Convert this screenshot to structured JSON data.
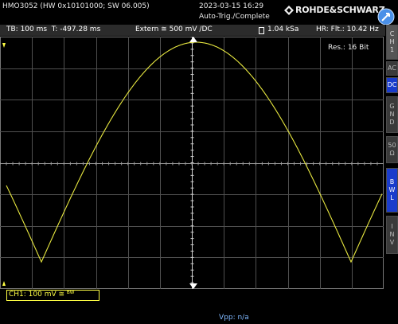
{
  "header": {
    "device": "HMO3052 (HW 0x10101000; SW 06.005)",
    "date": "2023-03-15 16:29",
    "trigger_state": "Auto-Trig./Complete",
    "brand": "ROHDE&SCHWARZ"
  },
  "status": {
    "timebase": "TB: 100 ms",
    "trigger_time": "T: -497.28 ms",
    "trigger_source": "Extern ≅ 500 mV ∕DC",
    "sample_rate": "1.04 kSa",
    "acquisition": "HR: Flt.: 10.42 Hz"
  },
  "plot": {
    "resolution": "Res.: 16 Bit",
    "trace_color": "#e8e840",
    "grid_color": "#505050"
  },
  "side_panel": {
    "channel": [
      "C",
      "H",
      "1"
    ],
    "ac": "AC",
    "dc": "DC",
    "gnd": [
      "G",
      "N",
      "D"
    ],
    "fifty": "50",
    "bwl": [
      "B",
      "W",
      "L"
    ],
    "inv": [
      "I",
      "N",
      "V"
    ]
  },
  "footer": {
    "ch1": "CH1: 100 mV ≅ ᴮᵂ",
    "vpp": "Vpp: n/a"
  },
  "icons": [
    "rohde-schwarz-logo-icon",
    "usb-icon",
    "sample-rate-icon",
    "trigger-marker-icon",
    "ground-marker-icon"
  ]
}
